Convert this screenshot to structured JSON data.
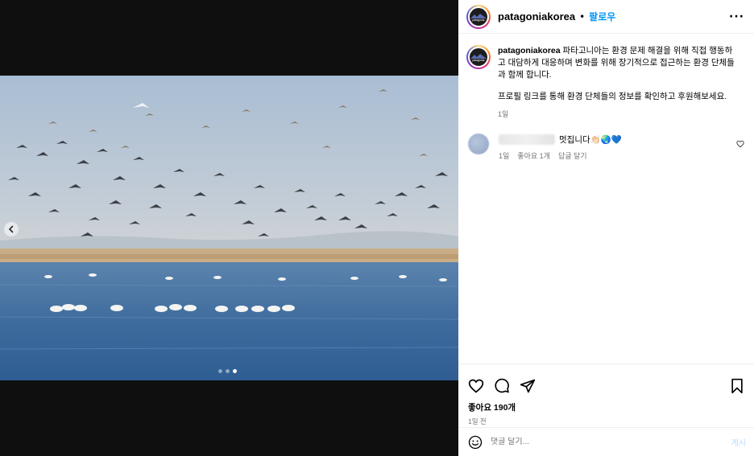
{
  "post": {
    "username": "patagoniakorea",
    "separator": "•",
    "follow_label": "팔로우",
    "more_label": "···",
    "avatar_label": "patagonia",
    "caption_username": "patagoniakorea",
    "caption_line1": "파타고니아는 환경 문제 해결을 위해 직접 행동하고 대담하게 대응하며 변화를 위해 장기적으로 접근하는 환경 단체들과 함께 합니다.",
    "caption_line2": "프로필 링크를 통해 환경 단체들의 정보를 확인하고 후원해보세요.",
    "caption_time": "1일",
    "likes": "좋아요 190개",
    "time": "1일 전"
  },
  "comment": {
    "text": "멋집니다👏🏻🌏💙",
    "time": "1일",
    "likes": "좋아요 1개",
    "reply": "답글 달기"
  },
  "comment_box": {
    "placeholder": "댓글 달기...",
    "post_label": "게시"
  },
  "carousel": {
    "total": 3,
    "active_index": 2
  },
  "colors": {
    "accent": "#0095f6",
    "muted": "#737373"
  },
  "icons": [
    "chevron-left-icon",
    "heart-icon",
    "comment-icon",
    "share-icon",
    "bookmark-icon",
    "emoji-icon",
    "more-icon"
  ]
}
